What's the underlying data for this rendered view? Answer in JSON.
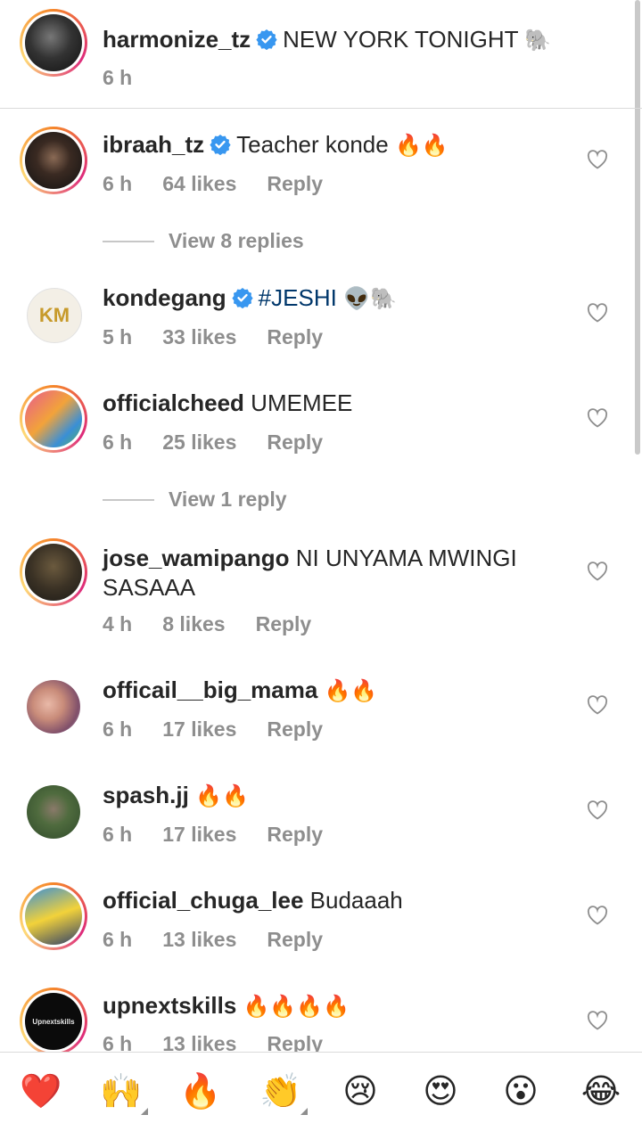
{
  "caption": {
    "username": "harmonize_tz",
    "text": "NEW YORK TONIGHT",
    "emoji": "🐘",
    "time": "6 h",
    "verified": true
  },
  "comments": [
    {
      "username": "ibraah_tz",
      "verified": true,
      "text": "Teacher konde",
      "emoji": "🔥🔥",
      "time": "6 h",
      "likes": "64 likes",
      "reply": "Reply"
    },
    {
      "username": "kondegang",
      "verified": true,
      "text": "#JESHI",
      "emoji": "👽🐘",
      "time": "5 h",
      "likes": "33 likes",
      "reply": "Reply",
      "avatar_text": "KM"
    },
    {
      "username": "officialcheed",
      "verified": false,
      "text": "UMEMEE",
      "emoji": "",
      "time": "6 h",
      "likes": "25 likes",
      "reply": "Reply"
    },
    {
      "username": "jose_wamipango",
      "verified": false,
      "text": "NI UNYAMA MWINGI",
      "text2": "SASAAA",
      "emoji": "",
      "time": "4 h",
      "likes": "8 likes",
      "reply": "Reply"
    },
    {
      "username": "officail__big_mama",
      "verified": false,
      "text": "",
      "emoji": "🔥🔥",
      "time": "6 h",
      "likes": "17 likes",
      "reply": "Reply"
    },
    {
      "username": "spash.jj",
      "verified": false,
      "text": "",
      "emoji": "🔥🔥",
      "time": "6 h",
      "likes": "17 likes",
      "reply": "Reply"
    },
    {
      "username": "official_chuga_lee",
      "verified": false,
      "text": "Budaaah",
      "emoji": "",
      "time": "6 h",
      "likes": "13 likes",
      "reply": "Reply"
    },
    {
      "username": "upnextskills",
      "verified": false,
      "text": "",
      "emoji": "🔥🔥🔥🔥",
      "time": "6 h",
      "likes": "13 likes",
      "reply": "Reply",
      "avatar_text": "Upnextskills"
    }
  ],
  "view_replies": [
    "View 8 replies",
    "View 1 reply"
  ],
  "reactions": [
    "❤️",
    "🙌",
    "🔥",
    "👏",
    "😢",
    "😍",
    "😮",
    "😂"
  ],
  "colors": {
    "verified": "#3897f0",
    "meta": "#8e8e8e",
    "hashtag": "#00376b",
    "heart": "#ed4956"
  }
}
